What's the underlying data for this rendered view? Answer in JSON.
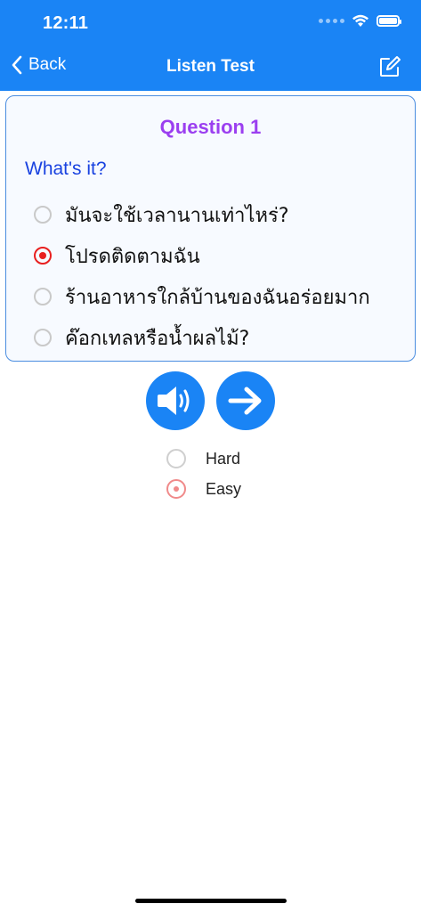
{
  "status_bar": {
    "time": "12:11"
  },
  "nav": {
    "back_label": "Back",
    "title": "Listen Test",
    "back_icon": "chevron-left-icon",
    "edit_icon": "compose-icon"
  },
  "question": {
    "title": "Question 1",
    "prompt": "What's it?",
    "options": [
      {
        "label": "มันจะใช้เวลานานเท่าไหร่?",
        "selected": false
      },
      {
        "label": "โปรดติดตามฉัน",
        "selected": true
      },
      {
        "label": "ร้านอาหารใกล้บ้านของฉันอร่อยมาก",
        "selected": false
      },
      {
        "label": "ค๊อกเทลหรือน้ำผลไม้?",
        "selected": false
      }
    ]
  },
  "actions": {
    "play_icon": "speaker-icon",
    "next_icon": "arrow-right-icon"
  },
  "difficulty": {
    "options": [
      {
        "label": "Hard",
        "selected": false
      },
      {
        "label": "Easy",
        "selected": true
      }
    ]
  },
  "colors": {
    "header": "#1a84f5",
    "question_title": "#9b3ff0",
    "prompt": "#1942e0",
    "selected_radio": "#e81f1f"
  }
}
